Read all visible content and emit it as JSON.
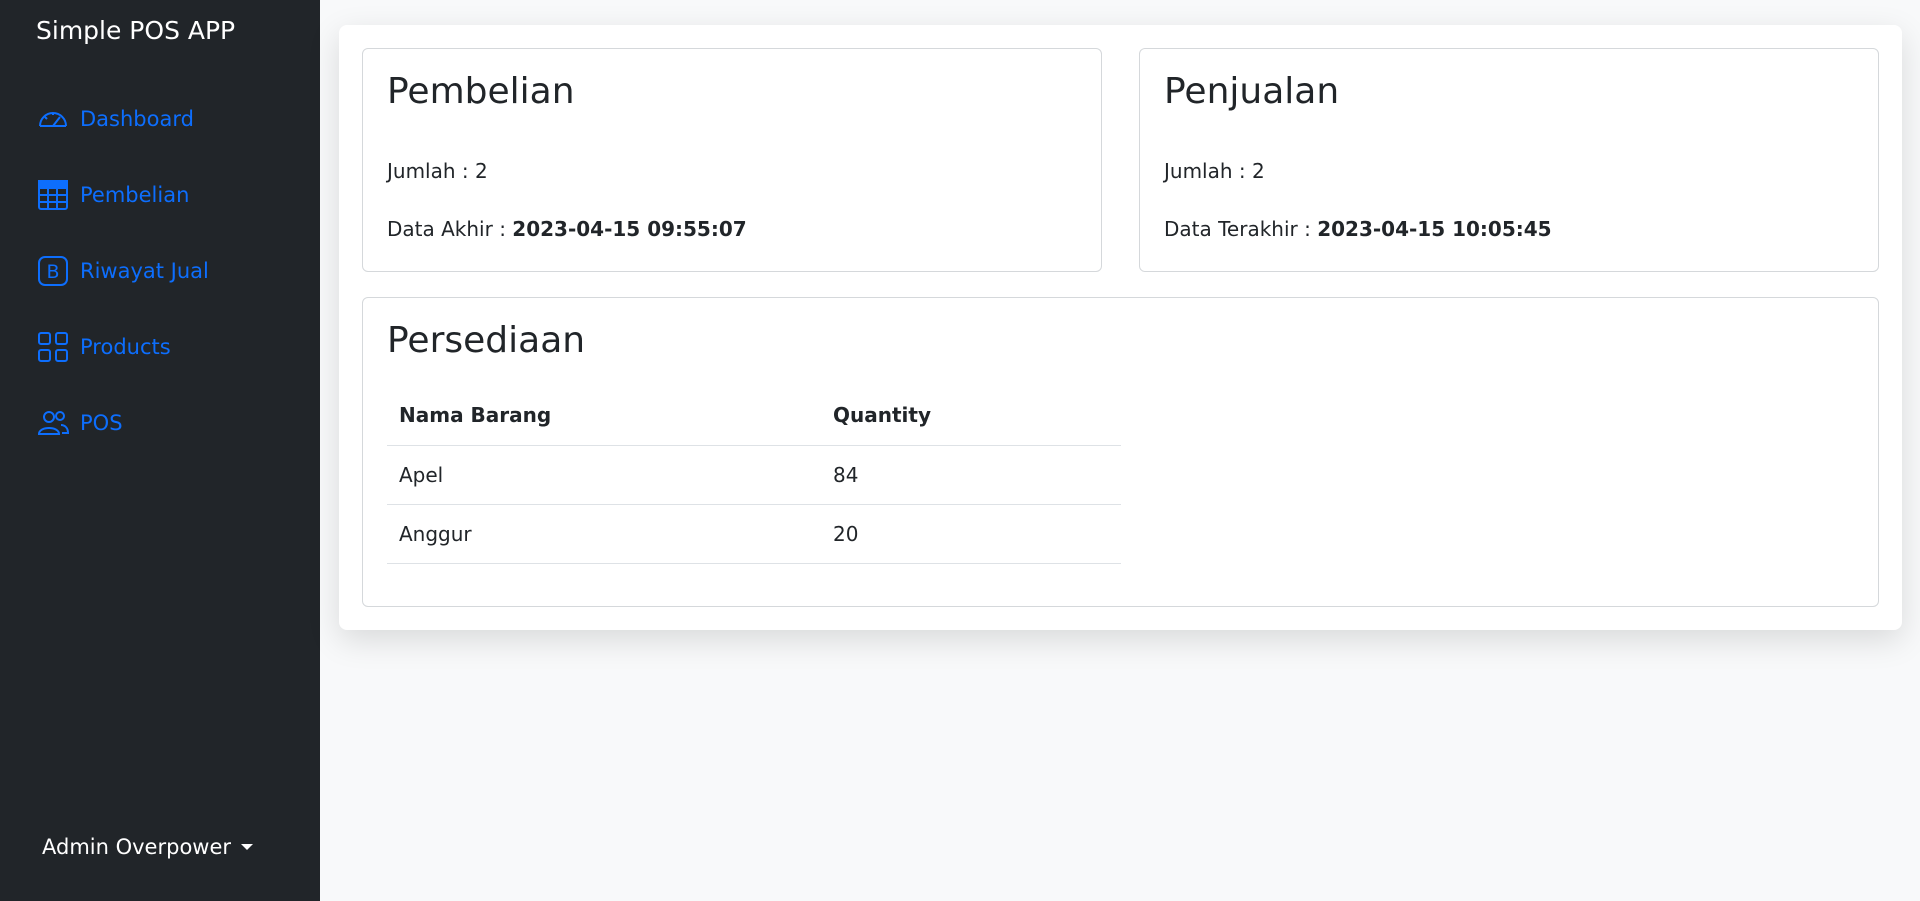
{
  "app": {
    "title": "Simple POS APP"
  },
  "sidebar": {
    "items": [
      {
        "label": "Dashboard",
        "icon": "speedometer-icon"
      },
      {
        "label": "Pembelian",
        "icon": "table-icon"
      },
      {
        "label": "Riwayat Jual",
        "icon": "bootstrap-icon"
      },
      {
        "label": "Products",
        "icon": "grid-icon"
      },
      {
        "label": "POS",
        "icon": "people-icon"
      }
    ],
    "user": {
      "name": "Admin Overpower"
    }
  },
  "pembelian": {
    "title": "Pembelian",
    "jumlah_label": "Jumlah : ",
    "jumlah": "2",
    "last_label": "Data Akhir : ",
    "last_value": "2023-04-15 09:55:07"
  },
  "penjualan": {
    "title": "Penjualan",
    "jumlah_label": "Jumlah : ",
    "jumlah": "2",
    "last_label": "Data Terakhir : ",
    "last_value": "2023-04-15 10:05:45"
  },
  "persediaan": {
    "title": "Persediaan",
    "columns": [
      "Nama Barang",
      "Quantity"
    ],
    "rows": [
      {
        "name": "Apel",
        "qty": "84"
      },
      {
        "name": "Anggur",
        "qty": "20"
      }
    ]
  },
  "colors": {
    "sidebar_bg": "#212529",
    "accent": "#0d6efd",
    "page_bg": "#f8f9fa"
  }
}
